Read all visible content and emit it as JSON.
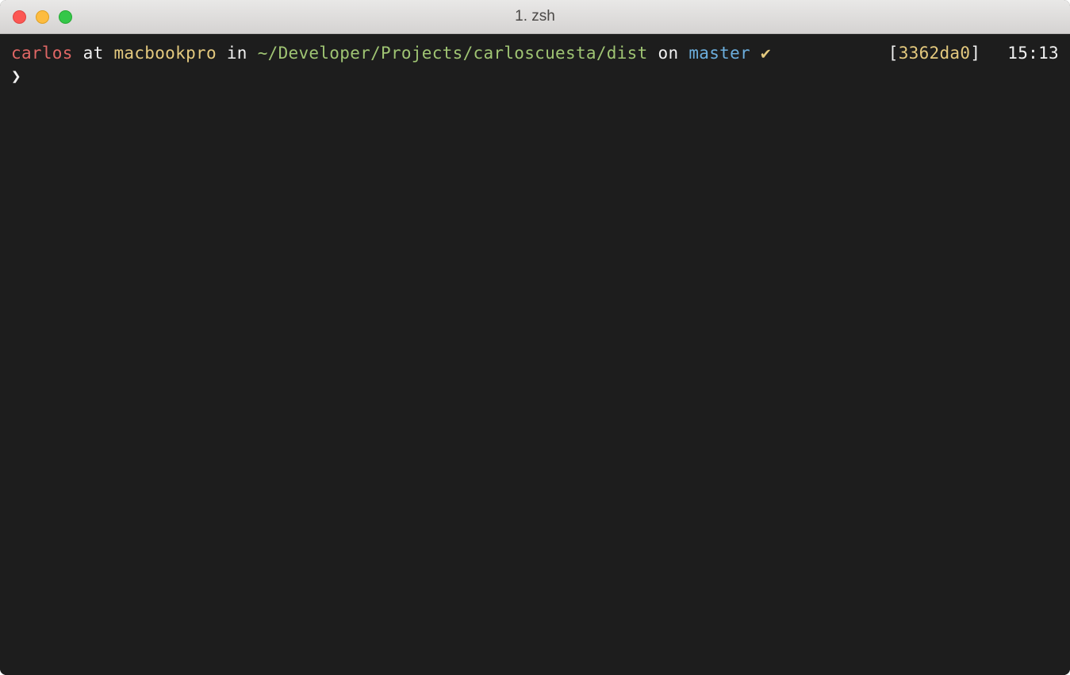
{
  "window": {
    "title": "1. zsh"
  },
  "prompt": {
    "user": "carlos",
    "sep_at": "at",
    "host": "macbookpro",
    "sep_in": "in",
    "path": "~/Developer/Projects/carloscuesta/dist",
    "sep_on": "on",
    "branch": "master",
    "status_icon": "✔",
    "bracket_open": "[",
    "commit_hash": "3362da0",
    "bracket_close": "]",
    "time": "15:13",
    "caret": "❯",
    "command": ""
  },
  "colors": {
    "bg": "#1d1d1d",
    "fg": "#f0f0f0",
    "user": "#e06765",
    "host": "#e4c97e",
    "path": "#9fc473",
    "branch": "#6caedd",
    "accent": "#e4c97e"
  }
}
